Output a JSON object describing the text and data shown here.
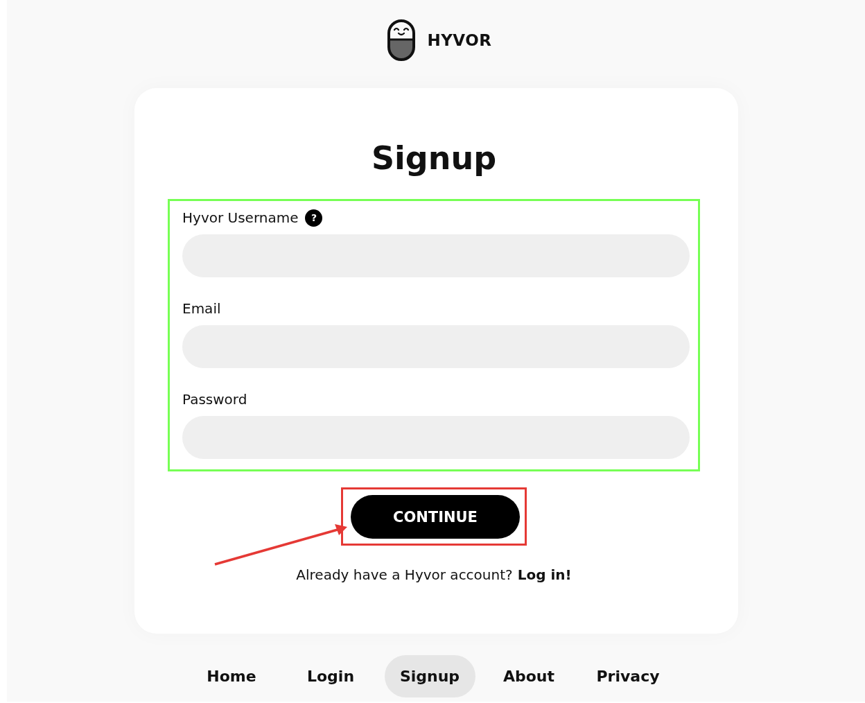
{
  "logo": {
    "text": "HYVOR"
  },
  "card": {
    "title": "Signup",
    "fields_frame": {
      "color": "#77ff55"
    },
    "fields": [
      {
        "label": "Hyvor Username",
        "help": "?"
      },
      {
        "label": "Email"
      },
      {
        "label": "Password"
      }
    ],
    "button_frame": {
      "color": "#e53935"
    },
    "button": "CONTINUE",
    "arrow": {
      "color": "#e53935"
    },
    "login_prompt": "Already have a Hyvor account?",
    "login_link": "Log in!"
  },
  "nav": [
    {
      "label": "Home",
      "selected": false
    },
    {
      "label": "Login",
      "selected": false
    },
    {
      "label": "Signup",
      "selected": true
    },
    {
      "label": "About",
      "selected": false
    },
    {
      "label": "Privacy",
      "selected": false
    }
  ]
}
